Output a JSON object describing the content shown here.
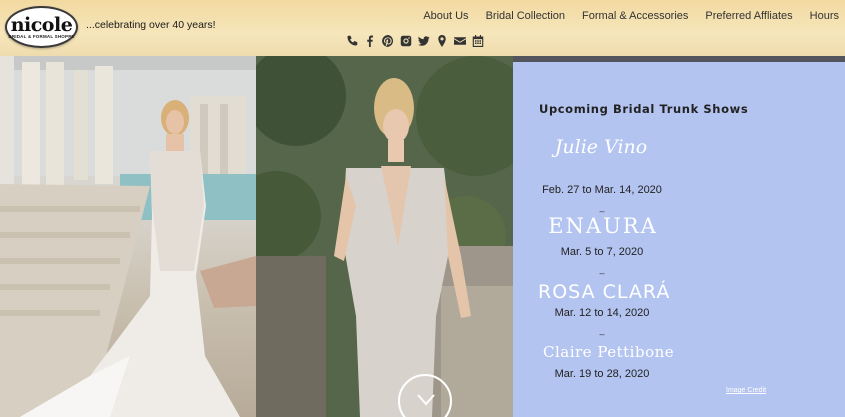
{
  "header": {
    "logo_word": "nicole",
    "logo_sub": "BRIDAL & FORMAL SHOPPE",
    "tagline": "...celebrating over 40 years!",
    "nav": [
      "About Us",
      "Bridal Collection",
      "Formal & Accessories",
      "Preferred Affliates",
      "Hours"
    ],
    "social_icons": [
      "phone-icon",
      "facebook-icon",
      "pinterest-icon",
      "instagram-icon",
      "twitter-icon",
      "map-pin-icon",
      "email-icon",
      "calendar-icon"
    ]
  },
  "panel": {
    "title": "Upcoming Bridal Trunk Shows",
    "shows": [
      {
        "brand": "Julie Vino",
        "dates": "Feb. 27 to Mar. 14, 2020"
      },
      {
        "brand": "ENAURA",
        "dates": "Mar. 5 to 7, 2020"
      },
      {
        "brand": "ROSA CLARÁ",
        "dates": "Mar. 12 to 14, 2020"
      },
      {
        "brand": "Claire Pettibone",
        "dates": "Mar. 19 to 28, 2020"
      }
    ],
    "separator": "–",
    "image_credit": "Image Credit"
  },
  "colors": {
    "header_bg": "#f3dfa9",
    "panel_bg": "#b4c4f0",
    "text_dark": "#222222"
  }
}
